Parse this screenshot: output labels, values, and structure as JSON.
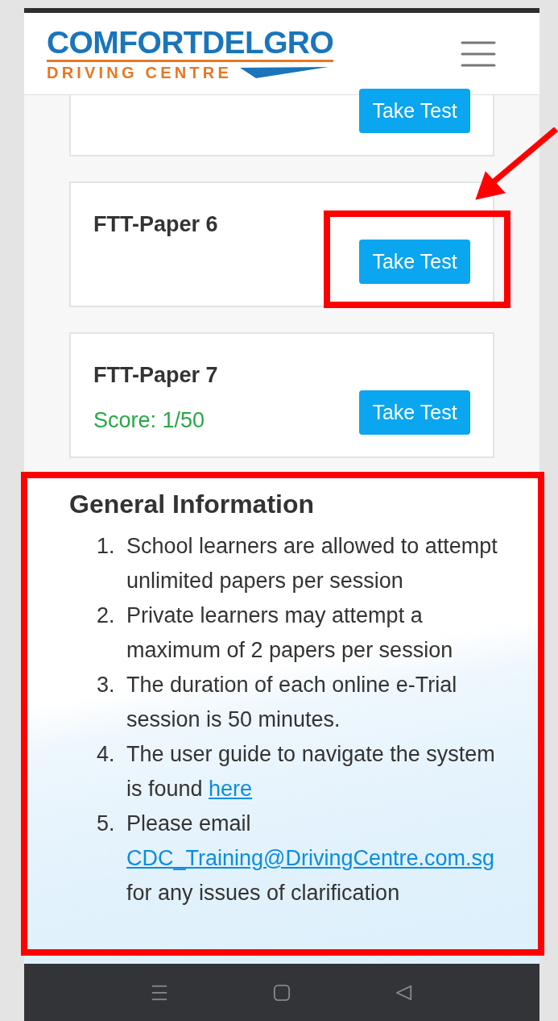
{
  "header": {
    "logo_top": "COMFORTDELGRO",
    "logo_bottom": "DRIVING CENTRE"
  },
  "papers": [
    {
      "button": "Take Test"
    },
    {
      "title": "FTT-Paper 6",
      "button": "Take Test"
    },
    {
      "title": "FTT-Paper 7",
      "score": "Score: 1/50",
      "button": "Take Test"
    }
  ],
  "general_information": {
    "title": "General Information",
    "items": [
      {
        "number": "1.",
        "text": "School learners are allowed to attempt unlimited papers per session"
      },
      {
        "number": "2.",
        "text": "Private learners may attempt a maximum of 2 papers per session"
      },
      {
        "number": "3.",
        "text": "The duration of each online e-Trial session is 50 minutes."
      },
      {
        "number": "4.",
        "text": "The user guide to navigate the system is found",
        "link": "here"
      },
      {
        "number": "5.",
        "text": "Please email",
        "link": "CDC_Training@DrivingCentre.com.sg",
        "after": "for any issues of clarification"
      }
    ]
  },
  "annotations": [
    {
      "kind": "arrow"
    },
    {
      "kind": "box"
    },
    {
      "kind": "box"
    }
  ]
}
